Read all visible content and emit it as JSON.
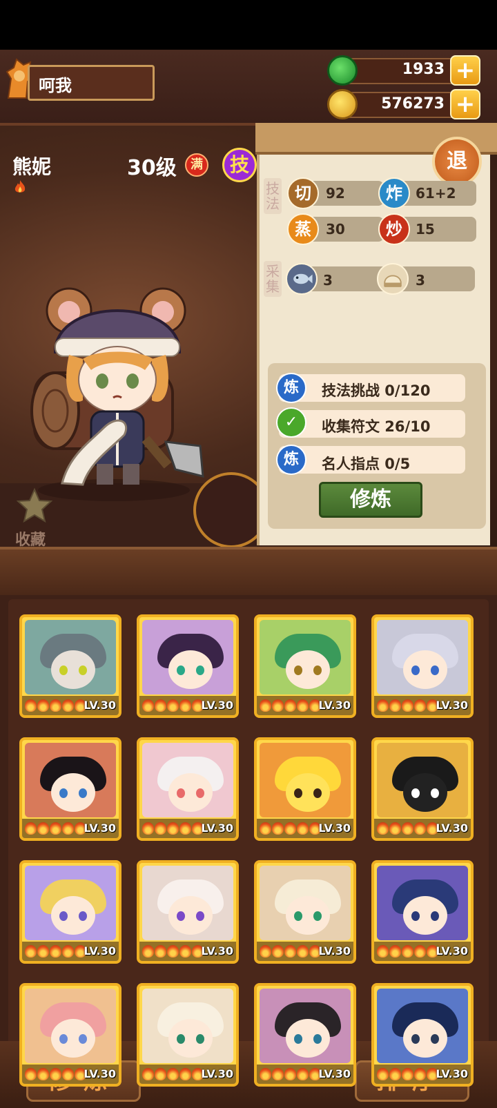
{
  "player": {
    "name": "呵我"
  },
  "resources": {
    "jade": {
      "value": "1933",
      "icon": "jade-coin-icon"
    },
    "gold": {
      "value": "576273",
      "icon": "gold-coin-icon"
    },
    "plus_label": "+"
  },
  "exit_label": "退",
  "hero": {
    "name": "熊妮",
    "level": "30级",
    "max_badge": "满",
    "skill_badge": "技",
    "favorite_label": "收藏"
  },
  "skills": {
    "section_label": "技法",
    "items": [
      {
        "glyph": "切",
        "value": "92",
        "color": "#a56a2a"
      },
      {
        "glyph": "炸",
        "value": "61+2",
        "color": "#2a8ac8"
      },
      {
        "glyph": "蒸",
        "value": "30",
        "color": "#e88a1a"
      },
      {
        "glyph": "炒",
        "value": "15",
        "color": "#c8321a"
      }
    ]
  },
  "gather": {
    "section_label": "采集",
    "items": [
      {
        "icon": "fish-icon",
        "value": "3"
      },
      {
        "icon": "bun-icon",
        "value": "3"
      }
    ]
  },
  "tasks": [
    {
      "icon_glyph": "炼",
      "text": "技法挑战 0/120",
      "done": false
    },
    {
      "icon_glyph": "✓",
      "text": "收集符文 26/10",
      "done": true
    },
    {
      "icon_glyph": "炼",
      "text": "名人指点 0/5",
      "done": false
    }
  ],
  "train_button": "修炼",
  "card_level": "LV.30",
  "cards": [
    {
      "name": "wolf-chef",
      "bg": "#7ea8a0",
      "hair": "#6a7a80",
      "skin": "#e8e0d8",
      "eye": "#c8d028"
    },
    {
      "name": "purple-hair-girl",
      "bg": "#c8a0d8",
      "hair": "#3a2448",
      "skin": "#fde9d8",
      "eye": "#2aa888"
    },
    {
      "name": "green-hair-girl",
      "bg": "#a8d068",
      "hair": "#3a9a5a",
      "skin": "#fde9d8",
      "eye": "#a07a20"
    },
    {
      "name": "silver-hair-boy",
      "bg": "#c8c8d8",
      "hair": "#d8d8e8",
      "skin": "#fde9d8",
      "eye": "#3a6ac8"
    },
    {
      "name": "black-hair-man",
      "bg": "#d87a5a",
      "hair": "#1a1418",
      "skin": "#fde9d8",
      "eye": "#3a7ac8"
    },
    {
      "name": "white-hair-girl",
      "bg": "#f0c8d0",
      "hair": "#f4f0f0",
      "skin": "#fde9d8",
      "eye": "#e86a6a"
    },
    {
      "name": "yellow-chick",
      "bg": "#f09a3a",
      "hair": "#ffd83a",
      "skin": "#ffe25a",
      "eye": "#3a2418"
    },
    {
      "name": "panda-goggles",
      "bg": "#e8b040",
      "hair": "#1a1a1a",
      "skin": "#222222",
      "eye": "#ffffff"
    },
    {
      "name": "blonde-crown-boy",
      "bg": "#b8a0e8",
      "hair": "#f0d060",
      "skin": "#fde9d8",
      "eye": "#6a5ac8"
    },
    {
      "name": "white-hood-girl",
      "bg": "#e8d8d0",
      "hair": "#f8f0ec",
      "skin": "#fde9d8",
      "eye": "#7a4ac8"
    },
    {
      "name": "cream-sheep-boy",
      "bg": "#e8d0b0",
      "hair": "#f6ecd6",
      "skin": "#fde9d8",
      "eye": "#2a9a6a"
    },
    {
      "name": "blue-hair-man",
      "bg": "#6a5ab8",
      "hair": "#2a3a78",
      "skin": "#fde9d8",
      "eye": "#2a3a78"
    },
    {
      "name": "twin-girls",
      "bg": "#f0c090",
      "hair": "#f0a0a0",
      "skin": "#fde9d8",
      "eye": "#6a8ad8"
    },
    {
      "name": "horn-girl",
      "bg": "#f0e0c8",
      "hair": "#f8f0e0",
      "skin": "#fde9d8",
      "eye": "#2a8a6a"
    },
    {
      "name": "dark-hair-boy",
      "bg": "#c890b8",
      "hair": "#2a2428",
      "skin": "#fde9d8",
      "eye": "#2a7a9a"
    },
    {
      "name": "headband-man",
      "bg": "#5a78c8",
      "hair": "#1a2a58",
      "skin": "#fde9d8",
      "eye": "#2a3a58"
    }
  ],
  "bottom": {
    "train_label": "修炼",
    "sort_label": "排序"
  }
}
